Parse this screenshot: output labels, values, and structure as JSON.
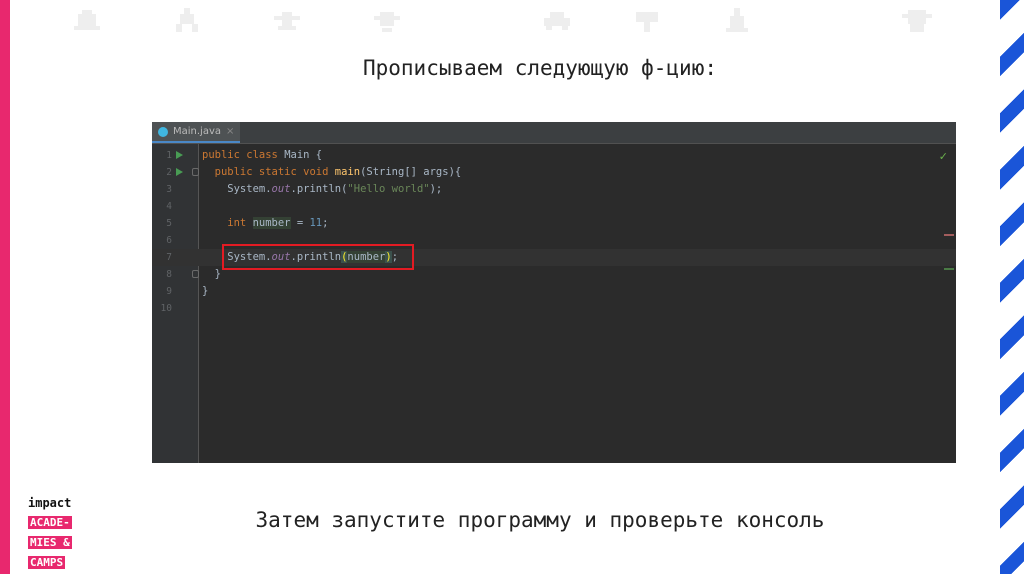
{
  "slide": {
    "heading": "Прописываем следующую ф-цию:",
    "footer_text": "Затем запустите программу и проверьте консоль"
  },
  "logo": {
    "line1": "impact",
    "line2": "ACADE-",
    "line3": "MIES &",
    "line4": "CAMPS"
  },
  "editor": {
    "tab_label": "Main.java",
    "tab_close": "×",
    "check_mark": "✓",
    "line_numbers": [
      "1",
      "2",
      "3",
      "4",
      "5",
      "6",
      "7",
      "8",
      "9",
      "10"
    ],
    "lines": {
      "l1_kw": "public class ",
      "l1_rest": "Main {",
      "l2_kw": "  public static void ",
      "l2_fn": "main",
      "l2_rest": "(String[] args){",
      "l3_a": "    System.",
      "l3_field": "out",
      "l3_b": ".println(",
      "l3_str": "\"Hello world\"",
      "l3_c": ");",
      "l5_kw": "    int ",
      "l5_var": "number",
      "l5_eq": " = ",
      "l5_num": "11",
      "l5_end": ";",
      "l7_a": "    System.",
      "l7_field": "out",
      "l7_b": ".println",
      "l7_open": "(",
      "l7_var": "number",
      "l7_close": ")",
      "l7_end": ";",
      "l8": "  }",
      "l9": "}"
    }
  },
  "colors": {
    "accent_pink": "#e8286e",
    "accent_blue": "#1a55d8",
    "highlight_red": "#e31b23"
  },
  "icons": [
    "run-icon",
    "fold-icon",
    "java-file-icon",
    "close-icon",
    "check-icon"
  ]
}
